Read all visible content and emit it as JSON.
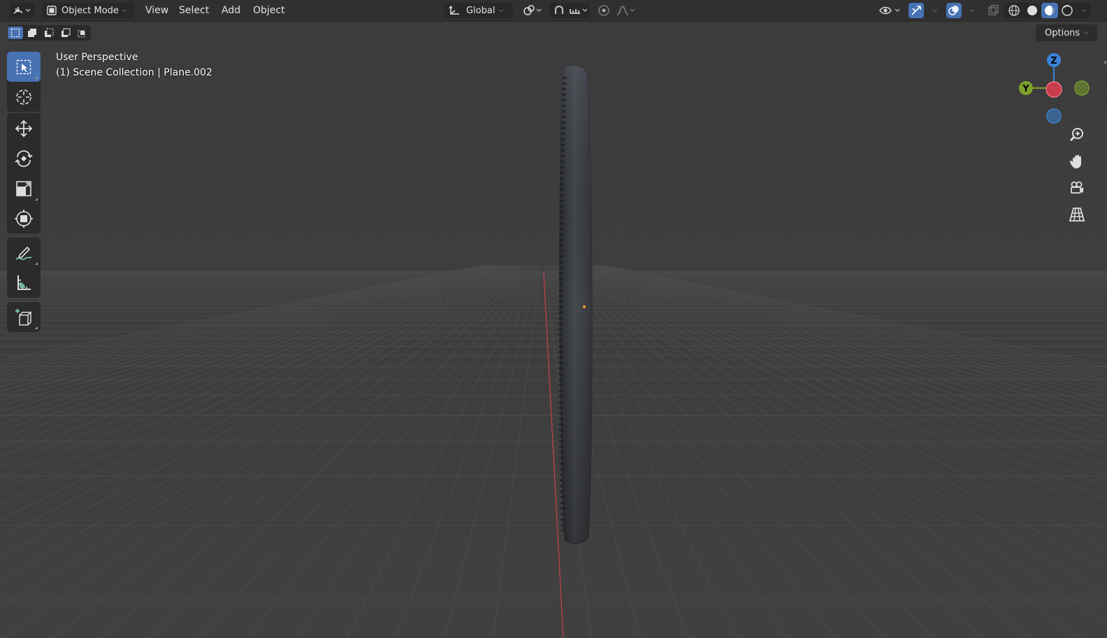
{
  "header": {
    "editor_type_icon": "3d-viewport-icon",
    "mode": "Object Mode",
    "menus": [
      "View",
      "Select",
      "Add",
      "Object"
    ],
    "transform_orientation": "Global"
  },
  "viewport": {
    "perspective_label": "User Perspective",
    "collection_label": "(1) Scene Collection | Plane.002",
    "options_label": "Options"
  },
  "gizmo": {
    "z_label": "Z",
    "y_label": "Y",
    "axis_colors": {
      "x": "#c83c4c",
      "y": "#7ca22a",
      "z": "#3c82d8"
    }
  },
  "toolbar": {
    "tools": [
      "select-box",
      "cursor",
      "move",
      "rotate",
      "scale",
      "transform",
      "annotate",
      "measure",
      "add-cube"
    ]
  },
  "colors": {
    "active": "#4772b3",
    "header": "#303030",
    "viewport": "#3d3d3d"
  }
}
